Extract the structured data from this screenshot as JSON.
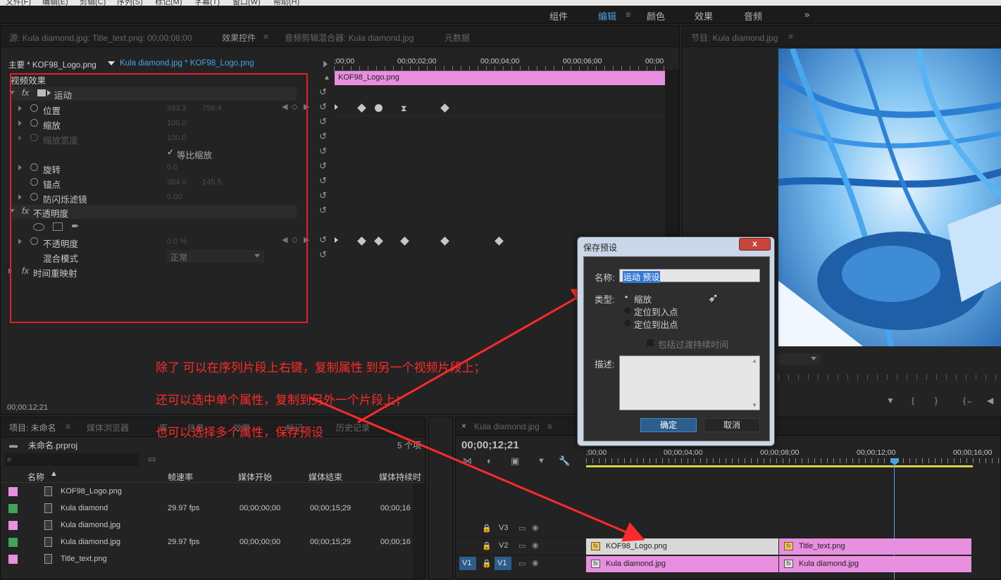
{
  "menubar": {
    "items": [
      "文件(F)",
      "编辑(E)",
      "剪辑(C)",
      "序列(S)",
      "标记(M)",
      "字幕(T)",
      "窗口(W)",
      "帮助(H)"
    ]
  },
  "workspace": {
    "tabs": [
      "组件",
      "编辑",
      "颜色",
      "效果",
      "音频"
    ],
    "active": "编辑",
    "overflow": "»"
  },
  "source_panel": {
    "tabs": [
      "源: Kula diamond.jpg: Title_text.png: 00;00;08;00",
      "效果控件",
      "音频剪辑混合器: Kula diamond.jpg",
      "元数据"
    ],
    "header_master": "主要 * KOF98_Logo.png",
    "header_clip": "Kula diamond.jpg * KOF98_Logo.png",
    "section": "视频效果",
    "timecodes": [
      ";00;00",
      "00;00;02;00",
      "00;00;04;00",
      "00;00;06;00",
      "00;00"
    ],
    "clip_bar": "KOF98_Logo.png",
    "effects": [
      {
        "label": "运动",
        "kind": "fx"
      },
      {
        "label": "位置",
        "v1": "393.3",
        "v2": "756.4"
      },
      {
        "label": "缩放",
        "v1": "100.0"
      },
      {
        "label": "缩放宽度",
        "v1": "100.0"
      },
      {
        "label": "等比缩放",
        "kind": "check"
      },
      {
        "label": "旋转",
        "v1": "0.0"
      },
      {
        "label": "锚点",
        "v1": "384.0",
        "v2": "145.5"
      },
      {
        "label": "防闪烁滤镜",
        "v1": "0.00"
      },
      {
        "label": "不透明度",
        "kind": "fx"
      },
      {
        "label": "不透明度",
        "v1": "0.0 %"
      },
      {
        "label": "混合模式",
        "v1": "正常"
      },
      {
        "label": "时间重映射",
        "kind": "fx"
      }
    ],
    "current_time": "00;00;12;21"
  },
  "program_panel": {
    "tab": "节目: Kula diamond.jpg"
  },
  "project_panel": {
    "tabs": [
      "项目: 未命名",
      "媒体浏览器",
      "库",
      "信息",
      "效果",
      "标记",
      "历史记录"
    ],
    "project_file": "未命名.prproj",
    "item_count": "5 个项",
    "columns": [
      "名称",
      "帧速率",
      "媒体开始",
      "媒体结束",
      "媒体持续时"
    ],
    "rows": [
      {
        "name": "KOF98_Logo.png",
        "fps": "",
        "start": "",
        "end": "",
        "dur": "",
        "color": "#e88fe0"
      },
      {
        "name": "Kula diamond",
        "fps": "29.97 fps",
        "start": "00;00;00;00",
        "end": "00;00;15;29",
        "dur": "00;00;16",
        "color": "#3fa35a"
      },
      {
        "name": "Kula diamond.jpg",
        "fps": "",
        "start": "",
        "end": "",
        "dur": "",
        "color": "#e88fe0"
      },
      {
        "name": "Kula diamond.jpg",
        "fps": "29.97 fps",
        "start": "00;00;00;00",
        "end": "00;00;15;29",
        "dur": "00;00;16",
        "color": "#3fa35a"
      },
      {
        "name": "Title_text.png",
        "fps": "",
        "start": "",
        "end": "",
        "dur": "",
        "color": "#e88fe0"
      }
    ]
  },
  "timeline_panel": {
    "tab": "Kula diamond.jpg",
    "timecode": "00;00;12;21",
    "ruler": [
      ";00;00",
      "00;00;04;00",
      "00;00;08;00",
      "00;00;12;00",
      "00;00;16;00"
    ],
    "tracks": [
      "V3",
      "V2",
      "V1"
    ],
    "src_track": "V1",
    "clips": {
      "v2a": "KOF98_Logo.png",
      "v2b": "Title_text.png",
      "v1a": "Kula diamond.jpg",
      "v1b": "Kula diamond.jpg"
    }
  },
  "dialog": {
    "title": "保存预设",
    "close": "x",
    "name_label": "名称:",
    "name_value": "运动 预设",
    "type_label": "类型:",
    "types": [
      "缩放",
      "定位到入点",
      "定位到出点"
    ],
    "selected_type": "缩放",
    "include_label": "包括过渡持续时间",
    "desc_label": "描述:",
    "ok": "确定",
    "cancel": "取消"
  },
  "annotations": [
    "除了 可以在序列片段上右键，复制属性 到另一个视频片段上；",
    "还可以选中单个属性，复制到另外一个片段上；",
    "也可以选择多个属性，保存预设"
  ],
  "colors": {
    "accent": "#4aa3e0",
    "annotation": "#ff2a2a",
    "clip_pink": "#e88fe0",
    "clip_selected": "#d8d8d8",
    "ok_button": "#2c5e8c"
  }
}
